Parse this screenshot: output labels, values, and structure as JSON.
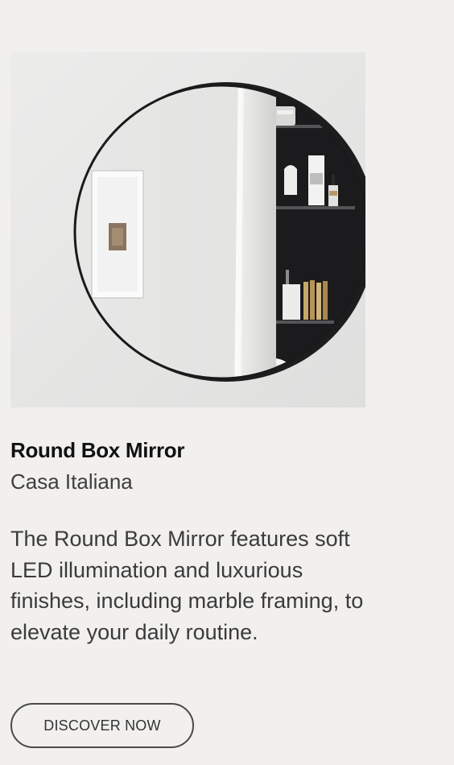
{
  "product": {
    "title": "Round Box Mirror",
    "brand": "Casa Italiana",
    "description": "The Round Box Mirror features soft LED illumination and luxurious finishes, including marble framing, to elevate your daily routine.",
    "cta_label": "DISCOVER NOW",
    "image_subject": "round-mirror-cabinet-photo"
  },
  "colors": {
    "page_background": "#f1f0ee",
    "title_text": "#111111",
    "body_text": "#3b3b3b",
    "button_border": "#4a4a4a",
    "cabinet_frame": "#1c1c1e"
  }
}
